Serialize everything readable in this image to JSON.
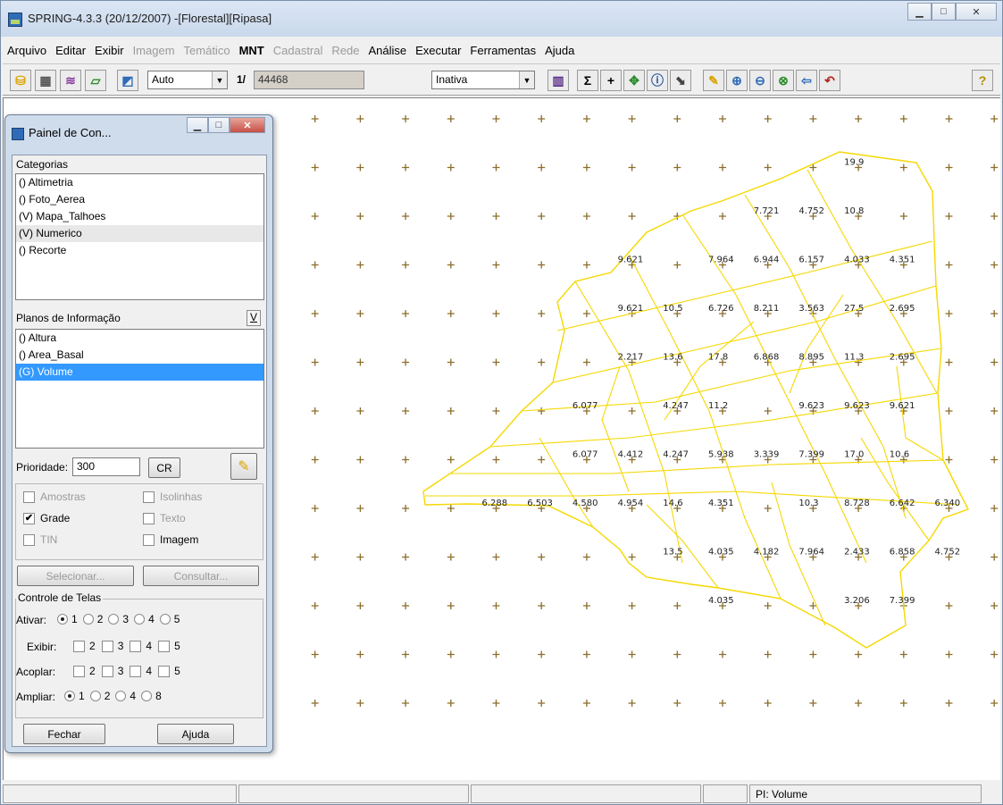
{
  "window": {
    "title": "SPRING-4.3.3 (20/12/2007) -[Florestal][Ripasa]"
  },
  "menu": [
    {
      "label": "Arquivo",
      "state": "enabled"
    },
    {
      "label": "Editar",
      "state": "enabled"
    },
    {
      "label": "Exibir",
      "state": "enabled"
    },
    {
      "label": "Imagem",
      "state": "disabled"
    },
    {
      "label": "Temático",
      "state": "disabled"
    },
    {
      "label": "MNT",
      "state": "bold"
    },
    {
      "label": "Cadastral",
      "state": "disabled"
    },
    {
      "label": "Rede",
      "state": "disabled"
    },
    {
      "label": "Análise",
      "state": "enabled"
    },
    {
      "label": "Executar",
      "state": "enabled"
    },
    {
      "label": "Ferramentas",
      "state": "enabled"
    },
    {
      "label": "Ajuda",
      "state": "enabled"
    }
  ],
  "toolbar": {
    "zoom_mode": "Auto",
    "scale_prefix": "1/",
    "scale_value": "44468",
    "mode": "Inativa",
    "help_glyph": "?"
  },
  "panel": {
    "title": "Painel de Con...",
    "categorias_label": "Categorias",
    "categorias": [
      "() Altimetria",
      "() Foto_Aerea",
      "(V) Mapa_Talhoes",
      "(V) Numerico",
      "() Recorte"
    ],
    "categorias_highlight_index": 3,
    "planos_label": "Planos de Informação",
    "planos_v_button": "V",
    "planos": [
      "() Altura",
      "() Area_Basal",
      "(G) Volume"
    ],
    "planos_selected_index": 2,
    "prioridade_label": "Prioridade:",
    "prioridade_value": "300",
    "cr_button": "CR",
    "options": {
      "amostras": "Amostras",
      "isolinhas": "Isolinhas",
      "grade": "Grade",
      "texto": "Texto",
      "tin": "TIN",
      "imagem": "Imagem",
      "grade_checked": "✔"
    },
    "selecionar_button": "Selecionar...",
    "consultar_button": "Consultar...",
    "controle_label": "Controle de Telas",
    "ativar_label": "Ativar:",
    "exibir_label": "Exibir:",
    "acoplar_label": "Acoplar:",
    "ampliar_label": "Ampliar:",
    "ativar_options": [
      "1",
      "2",
      "3",
      "4",
      "5"
    ],
    "screen_options": [
      "2",
      "3",
      "4",
      "5"
    ],
    "ampliar_options": [
      "1",
      "2",
      "4",
      "8"
    ],
    "fechar_button": "Fechar",
    "ajuda_button": "Ajuda"
  },
  "map": {
    "polygon_color": "#f5d800",
    "grid_color": "#8b6d2a",
    "labels": [
      {
        "text": "19.9",
        "gx": 13,
        "gy": 1
      },
      {
        "text": "7.721",
        "gx": 11,
        "gy": 2
      },
      {
        "text": "4.752",
        "gx": 12,
        "gy": 2
      },
      {
        "text": "10.8",
        "gx": 13,
        "gy": 2
      },
      {
        "text": "9.621",
        "gx": 8,
        "gy": 3
      },
      {
        "text": "7.964",
        "gx": 10,
        "gy": 3
      },
      {
        "text": "6.944",
        "gx": 11,
        "gy": 3
      },
      {
        "text": "6.157",
        "gx": 12,
        "gy": 3
      },
      {
        "text": "4.033",
        "gx": 13,
        "gy": 3
      },
      {
        "text": "4.351",
        "gx": 14,
        "gy": 3
      },
      {
        "text": "9.621",
        "gx": 8,
        "gy": 4
      },
      {
        "text": "10.5",
        "gx": 9,
        "gy": 4
      },
      {
        "text": "6.726",
        "gx": 10,
        "gy": 4
      },
      {
        "text": "8.211",
        "gx": 11,
        "gy": 4
      },
      {
        "text": "3.563",
        "gx": 12,
        "gy": 4
      },
      {
        "text": "27.5",
        "gx": 13,
        "gy": 4
      },
      {
        "text": "2.695",
        "gx": 14,
        "gy": 4
      },
      {
        "text": "2.217",
        "gx": 8,
        "gy": 5
      },
      {
        "text": "13.6",
        "gx": 9,
        "gy": 5
      },
      {
        "text": "17.8",
        "gx": 10,
        "gy": 5
      },
      {
        "text": "6.868",
        "gx": 11,
        "gy": 5
      },
      {
        "text": "8.895",
        "gx": 12,
        "gy": 5
      },
      {
        "text": "11.3",
        "gx": 13,
        "gy": 5
      },
      {
        "text": "2.695",
        "gx": 14,
        "gy": 5
      },
      {
        "text": "6.077",
        "gx": 7,
        "gy": 6
      },
      {
        "text": "4.247",
        "gx": 9,
        "gy": 6
      },
      {
        "text": "11.2",
        "gx": 10,
        "gy": 6
      },
      {
        "text": "9.623",
        "gx": 12,
        "gy": 6
      },
      {
        "text": "9.623",
        "gx": 13,
        "gy": 6
      },
      {
        "text": "9.621",
        "gx": 14,
        "gy": 6
      },
      {
        "text": "6.077",
        "gx": 7,
        "gy": 7
      },
      {
        "text": "4.412",
        "gx": 8,
        "gy": 7
      },
      {
        "text": "4.247",
        "gx": 9,
        "gy": 7
      },
      {
        "text": "5.938",
        "gx": 10,
        "gy": 7
      },
      {
        "text": "3.339",
        "gx": 11,
        "gy": 7
      },
      {
        "text": "7.399",
        "gx": 12,
        "gy": 7
      },
      {
        "text": "17.0",
        "gx": 13,
        "gy": 7
      },
      {
        "text": "10.6",
        "gx": 14,
        "gy": 7
      },
      {
        "text": "6.288",
        "gx": 5,
        "gy": 8
      },
      {
        "text": "6.503",
        "gx": 6,
        "gy": 8
      },
      {
        "text": "4.580",
        "gx": 7,
        "gy": 8
      },
      {
        "text": "4.954",
        "gx": 8,
        "gy": 8
      },
      {
        "text": "14.6",
        "gx": 9,
        "gy": 8
      },
      {
        "text": "4.351",
        "gx": 10,
        "gy": 8
      },
      {
        "text": "10.3",
        "gx": 12,
        "gy": 8
      },
      {
        "text": "8.728",
        "gx": 13,
        "gy": 8
      },
      {
        "text": "6.642",
        "gx": 14,
        "gy": 8
      },
      {
        "text": "6.340",
        "gx": 15,
        "gy": 8
      },
      {
        "text": "13.5",
        "gx": 9,
        "gy": 9
      },
      {
        "text": "4.035",
        "gx": 10,
        "gy": 9
      },
      {
        "text": "4.182",
        "gx": 11,
        "gy": 9
      },
      {
        "text": "7.964",
        "gx": 12,
        "gy": 9
      },
      {
        "text": "2.433",
        "gx": 13,
        "gy": 9
      },
      {
        "text": "6.858",
        "gx": 14,
        "gy": 9
      },
      {
        "text": "4.752",
        "gx": 15,
        "gy": 9
      },
      {
        "text": "4.035",
        "gx": 10,
        "gy": 10
      },
      {
        "text": "3.206",
        "gx": 13,
        "gy": 10
      },
      {
        "text": "7.399",
        "gx": 14,
        "gy": 10
      }
    ]
  },
  "status": {
    "pi": "PI: Volume"
  }
}
